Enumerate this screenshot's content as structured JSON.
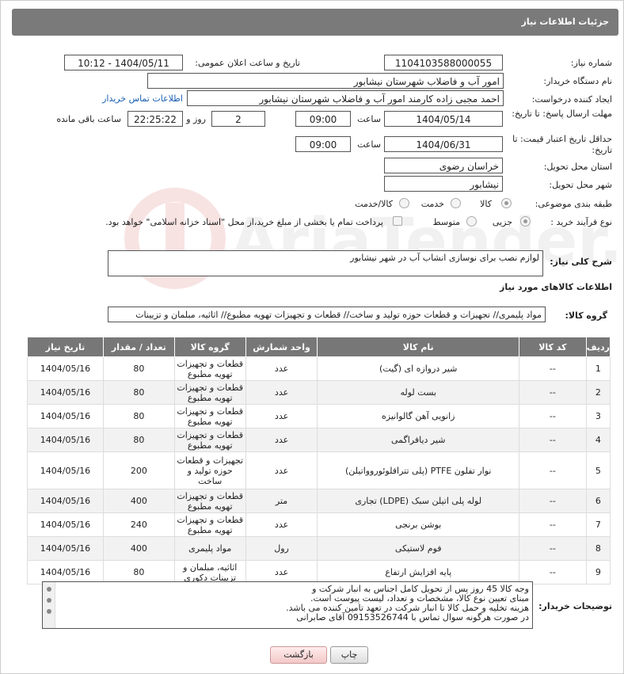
{
  "header": {
    "title": "جزئیات اطلاعات نیاز"
  },
  "form": {
    "need_number_label": "شماره نیاز:",
    "need_number": "1104103588000055",
    "announce_label": "تاریخ و ساعت اعلان عمومی:",
    "announce_value": "1404/05/11 - 10:12",
    "buyer_org_label": "نام دستگاه خریدار:",
    "buyer_org": "امور آب و فاضلاب شهرستان نیشابور",
    "requester_label": "ایجاد کننده درخواست:",
    "requester": "احمد مجبی زاده کارمند امور آب و فاضلاب شهرستان نیشابور",
    "buyer_contact_link": "اطلاعات تماس خریدار",
    "reply_deadline_label": "مهلت ارسال پاسخ: تا تاریخ:",
    "reply_date": "1404/05/14",
    "time_label": "ساعت",
    "reply_time": "09:00",
    "days_value": "2",
    "days_label": "روز و",
    "remaining_time": "22:25:22",
    "remaining_label": "ساعت باقی مانده",
    "min_price_label": "حداقل تاریخ اعتبار قیمت: تا تاریخ:",
    "price_date": "1404/06/31",
    "price_time": "09:00",
    "province_label": "استان محل تحویل:",
    "province": "خراسان رضوی",
    "city_label": "شهر محل تحویل:",
    "city": "نیشابور",
    "category_label": "طبقه بندی موضوعی:",
    "category_options": [
      "کالا",
      "خدمت",
      "کالا/خدمت"
    ],
    "process_label": "نوع فرآیند خرید :",
    "process_options": [
      "جزیی",
      "متوسط"
    ],
    "payment_note": "پرداخت تمام یا بخشی از مبلغ خرید،از محل \"اسناد خزانه اسلامی\" خواهد بود.",
    "description_label": "شرح کلی نیاز:",
    "description": "لوازم نصب برای نوسازی انشاب آب در شهر نیشابور",
    "goods_info_title": "اطلاعات کالاهای مورد نیاز",
    "goods_group_label": "گروه کالا:",
    "goods_group": "مواد پلیمری// تجهیزات و قطعات حوزه تولید و ساخت//  قطعات و تجهیزات تهویه مطبوع// اثاثیه، مبلمان و تزیینات"
  },
  "table": {
    "headers": [
      "ردیف",
      "کد کالا",
      "نام کالا",
      "واحد شمارش",
      "گروه کالا",
      "تعداد / مقدار",
      "تاریخ نیاز"
    ],
    "rows": [
      {
        "n": "1",
        "code": "--",
        "name": "شیر دروازه ای (گیت)",
        "unit": "عدد",
        "group": "قطعات و تجهیزات تهویه مطبوع",
        "qty": "80",
        "date": "1404/05/16"
      },
      {
        "n": "2",
        "code": "--",
        "name": "بست لوله",
        "unit": "عدد",
        "group": "قطعات و تجهیزات تهویه مطبوع",
        "qty": "80",
        "date": "1404/05/16"
      },
      {
        "n": "3",
        "code": "--",
        "name": "زانویی آهن گالوانیزه",
        "unit": "عدد",
        "group": "قطعات و تجهیزات تهویه مطبوع",
        "qty": "80",
        "date": "1404/05/16"
      },
      {
        "n": "4",
        "code": "--",
        "name": "شیر دیافراگمی",
        "unit": "عدد",
        "group": "قطعات و تجهیزات تهویه مطبوع",
        "qty": "80",
        "date": "1404/05/16"
      },
      {
        "n": "5",
        "code": "--",
        "name": "نوار تفلون PTFE (پلی تترافلوئوروواتیلن)",
        "unit": "عدد",
        "group": "تجهیزات و قطعات حوزه تولید و ساخت",
        "qty": "200",
        "date": "1404/05/16"
      },
      {
        "n": "6",
        "code": "--",
        "name": "لوله پلی اتیلن سبک (LDPE) تجاری",
        "unit": "متر",
        "group": "قطعات و تجهیزات تهویه مطبوع",
        "qty": "400",
        "date": "1404/05/16"
      },
      {
        "n": "7",
        "code": "--",
        "name": "بوشن برنجی",
        "unit": "عدد",
        "group": "قطعات و تجهیزات تهویه مطبوع",
        "qty": "240",
        "date": "1404/05/16"
      },
      {
        "n": "8",
        "code": "--",
        "name": "فوم لاستیکی",
        "unit": "رول",
        "group": "مواد پلیمری",
        "qty": "400",
        "date": "1404/05/16"
      },
      {
        "n": "9",
        "code": "--",
        "name": "پایه افزایش ارتفاع",
        "unit": "عدد",
        "group": "اثاثیه، مبلمان و تزیینات دکوری",
        "qty": "80",
        "date": "1404/05/16"
      }
    ]
  },
  "notes": {
    "label": "توضیحات خریدار:",
    "lines": [
      "وجه کالا 45 روز پس از تحویل کامل اجناس به انبار شرکت و",
      "مبنای تعیین نوع کالا، مشخصات و تعداد، لیست پیوست است.",
      "هزینه تخلیه و حمل کالا تا انبار شرکت در تعهد تامین کننده می باشد.",
      "در صورت هرگونه سوال تماس با 09153526744 آقای صابرانی"
    ]
  },
  "buttons": {
    "print": "چاپ",
    "back": "بازگشت"
  },
  "watermark": {
    "text": "AriaTender.net"
  }
}
